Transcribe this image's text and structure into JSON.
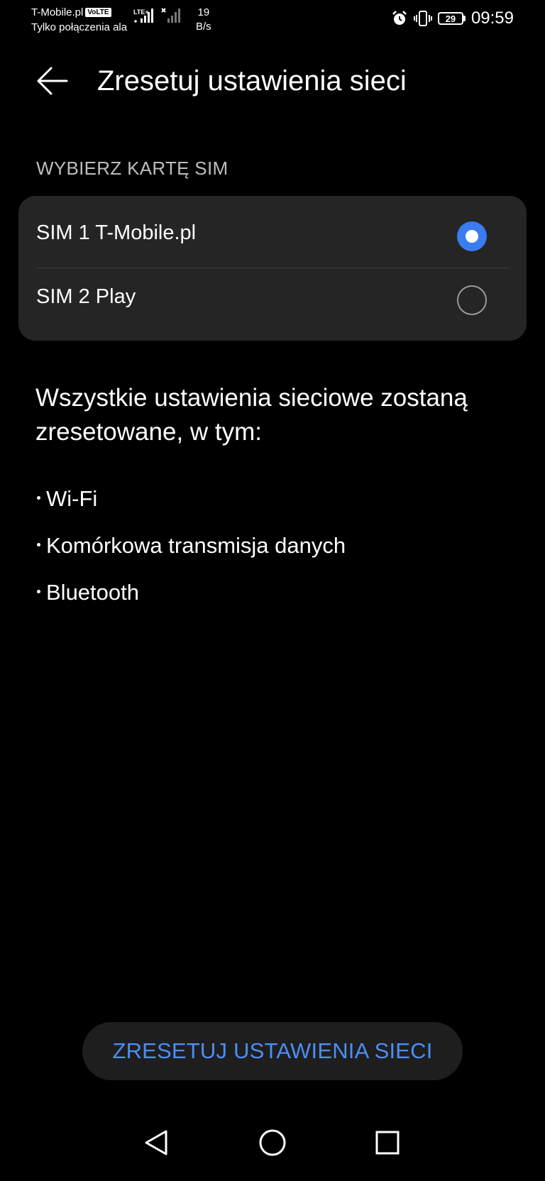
{
  "status_bar": {
    "carrier": "T-Mobile.pl",
    "volte": "VoLTE",
    "subtext": "Tylko połączenia ala",
    "network": "LTE+",
    "speed_value": "19",
    "speed_unit": "B/s",
    "battery": "29",
    "time": "09:59",
    "icons": [
      "signal-bars-icon",
      "signal-bars-icon",
      "alarm-icon",
      "vibrate-icon",
      "battery-icon"
    ]
  },
  "header": {
    "title": "Zresetuj ustawienia sieci",
    "back_icon": "arrow-left-icon"
  },
  "sim_section": {
    "label": "WYBIERZ KARTĘ SIM",
    "options": [
      {
        "label": "SIM 1 T-Mobile.pl",
        "selected": true
      },
      {
        "label": "SIM 2 Play",
        "selected": false
      }
    ]
  },
  "description": {
    "text": "Wszystkie ustawienia sieciowe zostaną zresetowane, w tym:",
    "items": [
      "Wi-Fi",
      "Komórkowa transmisja danych",
      "Bluetooth"
    ]
  },
  "action": {
    "reset_label": "ZRESETUJ USTAWIENIA SIECI"
  },
  "colors": {
    "accent": "#3a7bf0",
    "button_text": "#4d8df5",
    "card_bg": "#252525",
    "background": "#000000"
  },
  "nav_bar": {
    "buttons": [
      "back-triangle-icon",
      "home-circle-icon",
      "recents-square-icon"
    ]
  }
}
